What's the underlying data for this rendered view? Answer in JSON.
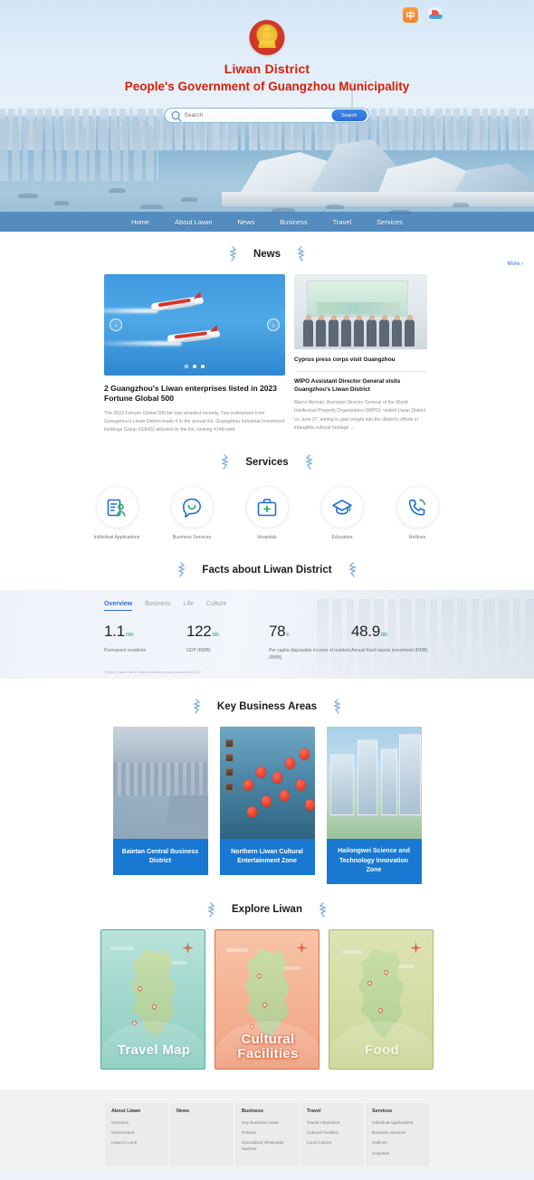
{
  "header": {
    "lang_toggle": "中",
    "badge_icon": "site-logo-icon",
    "emblem_icon": "national-emblem-icon",
    "title_line1": "Liwan District",
    "title_line2": "People's Government of Guangzhou Municipality",
    "search": {
      "placeholder": "Search",
      "value": "",
      "button_label": "Search",
      "icon": "search-icon"
    },
    "nav": [
      {
        "label": "Home"
      },
      {
        "label": "About Liwan"
      },
      {
        "label": "News"
      },
      {
        "label": "Business"
      },
      {
        "label": "Travel"
      },
      {
        "label": "Services"
      }
    ]
  },
  "news": {
    "section_title": "News",
    "more_label": "More ›",
    "carousel": {
      "prev_icon": "chevron-left-icon",
      "next_icon": "chevron-right-icon",
      "dots": 3,
      "active_dot": 0
    },
    "featured": {
      "title": "2 Guangzhou's Liwan enterprises listed in 2023 Fortune Global 500",
      "excerpt": "The 2023 Fortune Global 500 list was unveiled recently. Two enterprises from Guangzhou's Liwan District made it to the annual list. Guangzhou Industrial Investment Holdings Group (GIIHG) debuted on the list, ranking 414th with"
    },
    "side": {
      "headline1": "Cyprus press corps visit Guangzhou",
      "headline2": "WIPO Assistant Director General visits Guangzhou's Liwan District",
      "excerpt": "Marco Alemán, Assistant Director General of the World Intellectual Property Organization (WIPO), visited Liwan District on June 27, aiming to gain insight into the district's efforts in intangible cultural heritage ..."
    }
  },
  "services": {
    "section_title": "Services",
    "items": [
      {
        "label": "Individual Applications",
        "icon": "individual-applications-icon"
      },
      {
        "label": "Business Services",
        "icon": "business-services-icon"
      },
      {
        "label": "Hospitals",
        "icon": "hospitals-icon"
      },
      {
        "label": "Education",
        "icon": "education-icon"
      },
      {
        "label": "Hotlines",
        "icon": "hotlines-icon"
      }
    ]
  },
  "facts": {
    "section_title": "Facts about Liwan District",
    "tabs": [
      {
        "label": "Overview",
        "active": true
      },
      {
        "label": "Business",
        "active": false
      },
      {
        "label": "Life",
        "active": false
      },
      {
        "label": "Culture",
        "active": false
      }
    ],
    "stats": [
      {
        "value": "1.1",
        "unit": "mln",
        "caption": "Permanent residents"
      },
      {
        "value": "122",
        "unit": "bln",
        "caption": "GDP (RMB)"
      },
      {
        "value": "78",
        "unit": "k",
        "caption": "Per capita disposable income of resident (RMB)"
      },
      {
        "value": "48.9",
        "unit": "bln",
        "caption": "Annual fixed assets investment (RMB)"
      }
    ],
    "source": "*Source: Liwan District Statistics Bureau Survey conducted in 2022"
  },
  "business_areas": {
    "section_title": "Key Business Areas",
    "cards": [
      {
        "caption": "Baietan Central Business District"
      },
      {
        "caption": "Northern Liwan Cultural Entertainment Zone"
      },
      {
        "caption": "Hailongwei Science and Technology Innovation Zone"
      }
    ]
  },
  "explore": {
    "section_title": "Explore Liwan",
    "cards": [
      {
        "label": "Travel Map"
      },
      {
        "label": "Cultural Facilities"
      },
      {
        "label": "Food"
      }
    ]
  },
  "footer": {
    "columns": [
      {
        "title": "About Liwan",
        "links": [
          "Overview",
          "Government",
          "Liwan in Lens"
        ]
      },
      {
        "title": "News",
        "links": []
      },
      {
        "title": "Business",
        "links": [
          "Key Business Areas",
          "Policies",
          "Specialized Wholesale Markets"
        ]
      },
      {
        "title": "Travel",
        "links": [
          "Tourist Attractions",
          "Cultural Facilities",
          "Local Cuisine"
        ]
      },
      {
        "title": "Services",
        "links": [
          "Individual Applications",
          "Business Services",
          "Hotlines",
          "Hospitals"
        ]
      }
    ]
  },
  "colors": {
    "brand_red": "#d81e06",
    "brand_blue": "#2a6fd0",
    "nav_blue": "#3a78b5",
    "card_blue": "#1878d2",
    "accent_green": "#3aa76d",
    "lang_orange": "#f5821f"
  }
}
